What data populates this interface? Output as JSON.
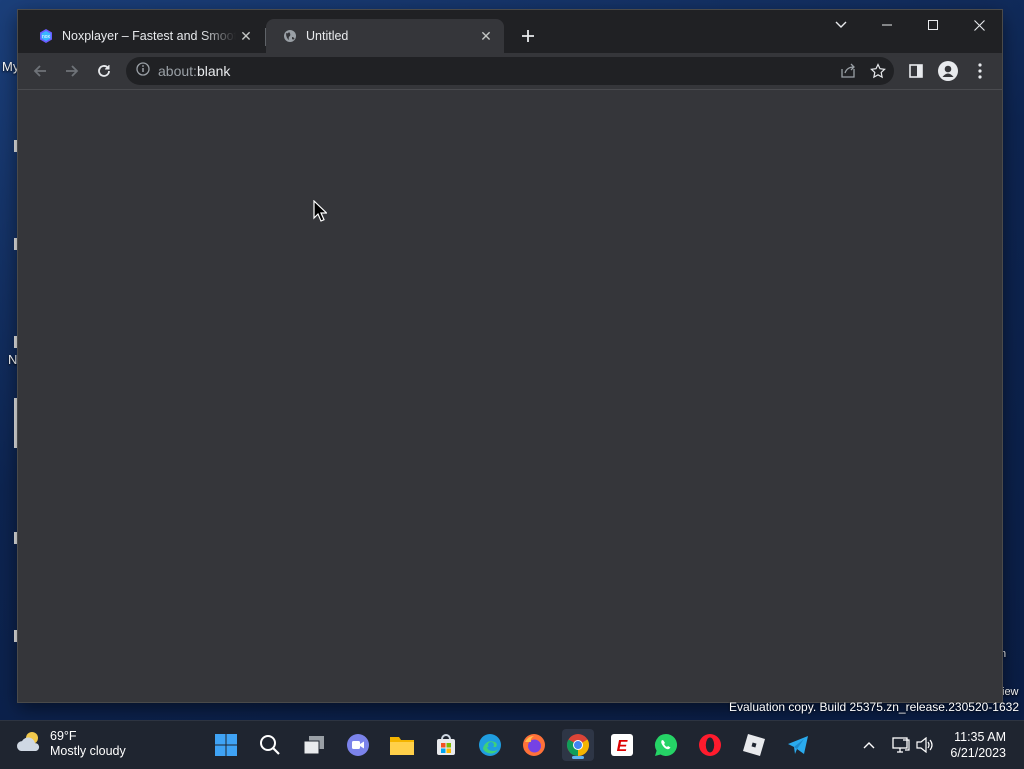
{
  "desktop": {
    "left_label": "My",
    "left_label_2": "N",
    "right_label": "n",
    "right_label_2": "iew"
  },
  "browser": {
    "tabs": [
      {
        "title": "Noxplayer – Fastest and Smoothest",
        "favicon": "noxplayer-favicon",
        "active": false
      },
      {
        "title": "Untitled",
        "favicon": "globe-icon",
        "active": true
      }
    ],
    "address": {
      "scheme": "about:",
      "path": "blank"
    },
    "page_background": "#35363a"
  },
  "watermark": "Evaluation copy. Build 25375.zn_release.230520-1632",
  "taskbar": {
    "weather": {
      "temp": "69°F",
      "condition": "Mostly cloudy"
    },
    "clock": {
      "time": "11:35 AM",
      "date": "6/21/2023"
    },
    "apps": [
      "start",
      "search",
      "task-view",
      "teams",
      "file-explorer",
      "store",
      "edge",
      "firefox",
      "chrome",
      "espn",
      "whatsapp",
      "opera",
      "roblox",
      "telegram"
    ]
  }
}
